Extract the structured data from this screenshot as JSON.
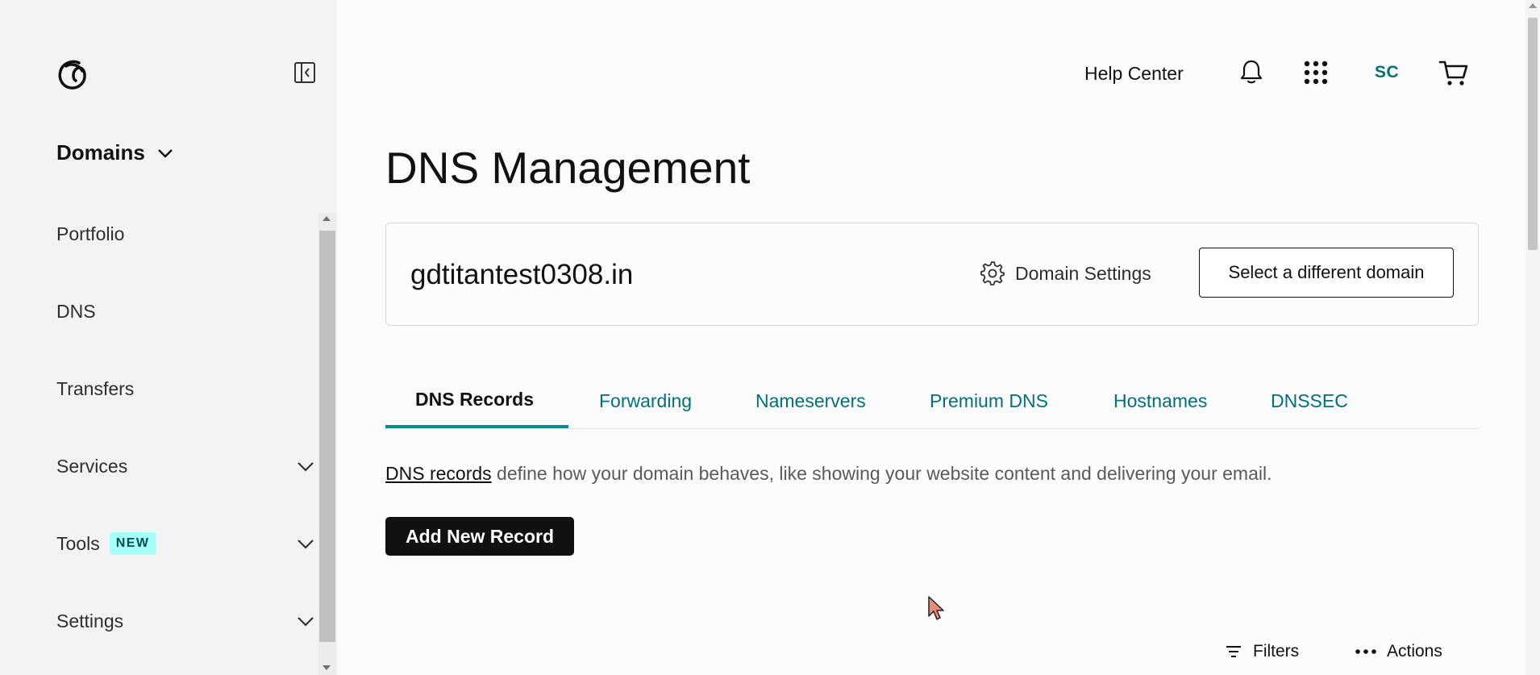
{
  "sidebar": {
    "logo_icon": "godaddy-logo-icon",
    "collapse_icon": "sidebar-collapse-icon",
    "section_title": "Domains",
    "items": [
      {
        "label": "Portfolio"
      },
      {
        "label": "DNS"
      },
      {
        "label": "Transfers"
      },
      {
        "label": "Services",
        "expandable": true
      },
      {
        "label": "Tools",
        "badge": "NEW",
        "expandable": true
      },
      {
        "label": "Settings",
        "expandable": true
      }
    ]
  },
  "header": {
    "help_label": "Help Center",
    "avatar_initials": "SC",
    "icons": [
      "bell-icon",
      "apps-grid-icon",
      "cart-icon"
    ]
  },
  "page": {
    "title": "DNS Management"
  },
  "domain_card": {
    "domain": "gdtitantest0308.in",
    "settings_label": "Domain Settings",
    "select_label": "Select a different domain"
  },
  "tabs": [
    {
      "label": "DNS Records",
      "active": true
    },
    {
      "label": "Forwarding"
    },
    {
      "label": "Nameservers"
    },
    {
      "label": "Premium DNS"
    },
    {
      "label": "Hostnames"
    },
    {
      "label": "DNSSEC"
    }
  ],
  "description": {
    "link_text": "DNS records",
    "rest": " define how your domain behaves, like showing your website content and delivering your email."
  },
  "add_button": "Add New Record",
  "toolbar": {
    "filters_label": "Filters",
    "actions_label": "Actions"
  },
  "colors": {
    "accent_teal": "#00707a",
    "tab_indicator": "#0a8a8f",
    "badge_bg": "#a6fff8",
    "primary_button": "#111111"
  }
}
